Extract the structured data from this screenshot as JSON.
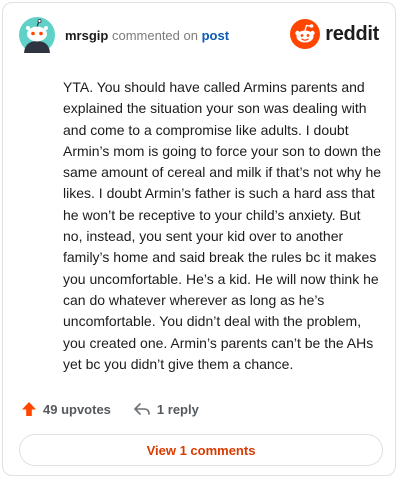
{
  "header": {
    "username": "mrsgip",
    "action_text": "commented on",
    "post_link": "post"
  },
  "brand": {
    "name": "reddit",
    "icon": "reddit-alien-icon",
    "color": "#ff4500"
  },
  "comment": {
    "body": "YTA. You should have called Armins parents and explained the situation your son was dealing with and come to a compromise like adults. I doubt Armin’s mom is going to force your son to down the same amount of cereal and milk if that’s not why he likes. I doubt Armin’s father is such a hard ass that he won’t be receptive to your child’s anxiety. But no, instead, you sent your kid over to another family’s home and said break the rules bc it makes you uncomfortable. He’s a kid. He will now think he can do whatever wherever as long as he’s uncomfortable. You didn’t deal with the problem, you created one. Armin’s parents can’t be the AHs yet bc you didn’t give them a chance."
  },
  "actions": {
    "upvotes": "49 upvotes",
    "upvote_icon": "upvote-arrow-icon",
    "replies": "1 reply",
    "reply_icon": "reply-arrow-icon"
  },
  "footer": {
    "view_comments": "View 1 comments"
  },
  "colors": {
    "accent": "#ff4500",
    "link": "#0a5bb5",
    "view_button_text": "#d93a00"
  }
}
